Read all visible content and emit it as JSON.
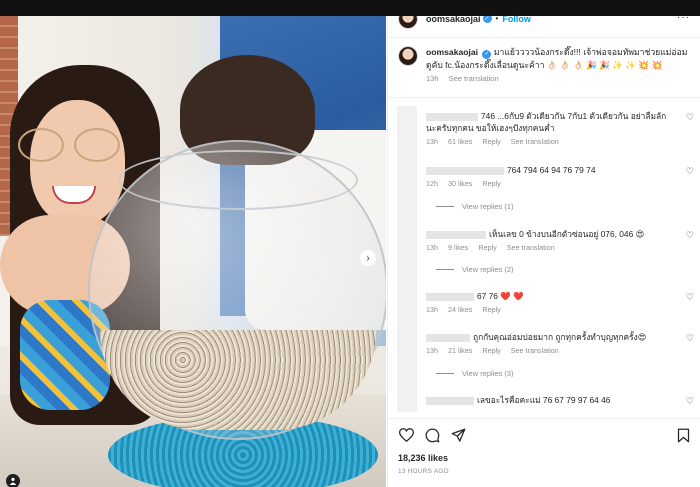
{
  "post": {
    "username": "oomsakaojai",
    "follow_label": "Follow",
    "dot": "•",
    "more_label": "···",
    "caption": "มาแย้ววววน้องกระดึ๊ง!!! เจ้าพ่อจอมทัพมาช่วยแม่อ่อมดูคับ fc.น้องกระดึ๊งเลื่อนดูนะค้าา 👌🏻 👌🏻 👌🏻 🎉 🎉 ✨ ✨ 💥 💥",
    "caption_time": "13h",
    "see_translation": "See translation",
    "photo_next_label": "›"
  },
  "comments": [
    {
      "text": "746 ...6กับ9 ตัวเดียวกัน 7กับ1 ตัวเดียวกัน อย่าลืมลักนะครับทุกคน ขอให้เฮงๆปังทุกคนค่ำ",
      "time": "13h",
      "likes": "61 likes",
      "reply": "Reply",
      "translate": "See translation",
      "view_replies": "View replies (1)"
    },
    {
      "text": "764 794 64 94 76 79 74",
      "time": "12h",
      "likes": "30 likes",
      "reply": "Reply",
      "translate": "",
      "view_replies": ""
    },
    {
      "text": "เห็นเลข 0 ข้างบนอีกตัวซ่อนอยู่ 076, 046 😍",
      "time": "13h",
      "likes": "9 likes",
      "reply": "Reply",
      "translate": "See translation",
      "view_replies": "View replies (2)"
    },
    {
      "text": "67 76 ❤️ ❤️",
      "time": "13h",
      "likes": "24 likes",
      "reply": "Reply",
      "translate": "",
      "view_replies": ""
    },
    {
      "text": "ถูกกับคุณอ่อมบ่อยมาก ถูกทุกครั้งทำบุญทุกครั้ง😍",
      "time": "13h",
      "likes": "21 likes",
      "reply": "Reply",
      "translate": "See translation",
      "view_replies": "View replies (3)"
    },
    {
      "text": "เลขอะไรคือคะแม่ 76 67 79 97 64 46",
      "time": "",
      "likes": "",
      "reply": "",
      "translate": "",
      "view_replies": ""
    }
  ],
  "icons": {
    "heart": "♡",
    "like": "heart-icon",
    "comment": "comment-icon",
    "share": "share-icon",
    "save": "bookmark-icon",
    "user_tag": "user-tag-icon"
  },
  "footer": {
    "likes": "18,236 likes",
    "time": "13 HOURS AGO"
  },
  "colors": {
    "accent": "#0095f6",
    "verified": "#3797f0",
    "heart_red": "#ed4956"
  }
}
